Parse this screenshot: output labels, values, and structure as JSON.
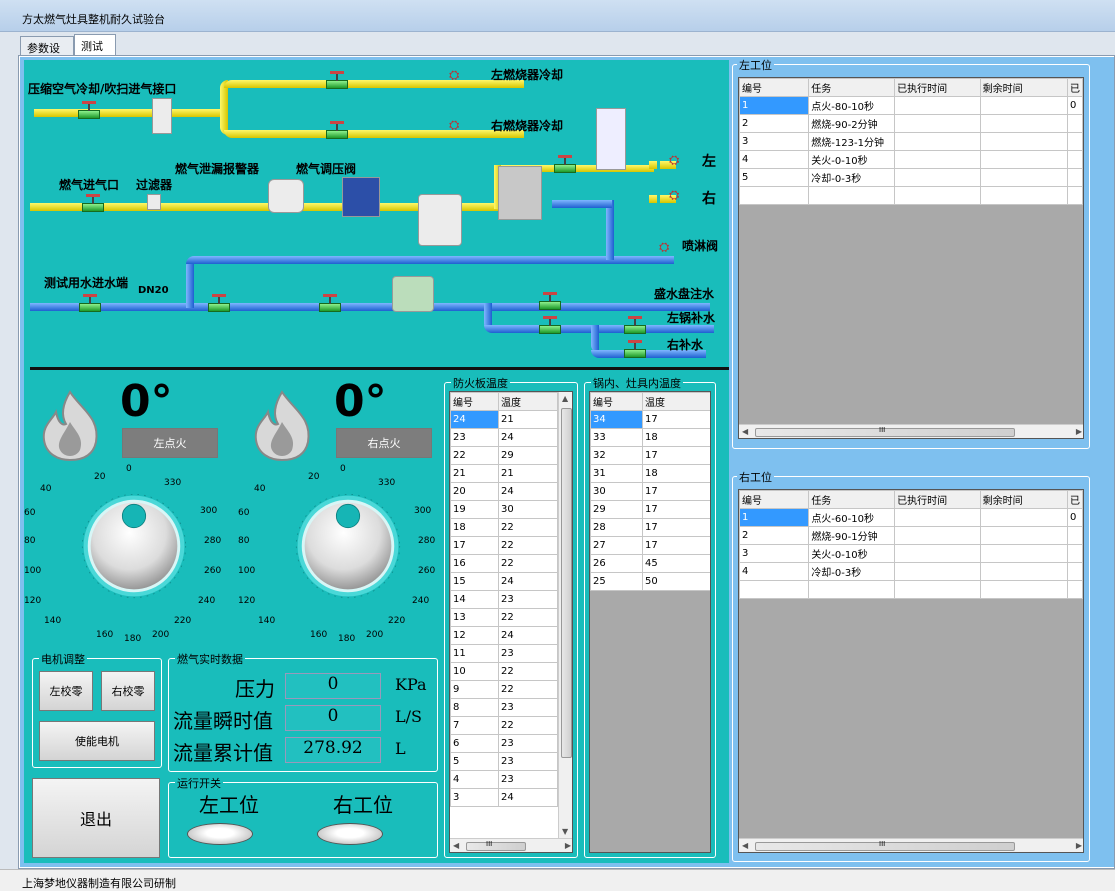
{
  "window": {
    "title": "方太燃气灶具整机耐久试验台"
  },
  "tabs": [
    "参数设置",
    "测试"
  ],
  "diagram": {
    "labels": {
      "air": "压缩空气冷却/吹扫进气接口",
      "left_burner_cool": "左燃烧器冷却",
      "right_burner_cool": "右燃烧器冷却",
      "gas_leak": "燃气泄漏报警器",
      "gas_reg": "燃气调压阀",
      "gas_in": "燃气进气口",
      "filter": "过滤器",
      "left": "左",
      "right": "右",
      "spray": "喷淋阀",
      "water_in": "测试用水进水端",
      "dn20": "DN20",
      "tray": "盛水盘注水",
      "left_pot": "左锅补水",
      "right_pot": "右补水"
    }
  },
  "left_burner": {
    "angle": "0°",
    "ignite": "左点火",
    "dial": [
      "0",
      "20",
      "40",
      "60",
      "80",
      "100",
      "120",
      "140",
      "160",
      "180",
      "200",
      "220",
      "240",
      "260",
      "280",
      "300",
      "330"
    ]
  },
  "right_burner": {
    "angle": "0°",
    "ignite": "右点火"
  },
  "motor": {
    "legend": "电机调整",
    "left_zero": "左校零",
    "right_zero": "右校零",
    "enable": "使能电机"
  },
  "gas": {
    "legend": "燃气实时数据",
    "pressure_label": "压力",
    "pressure": "0",
    "pressure_unit": "KPa",
    "flow_label": "流量瞬时值",
    "flow": "0",
    "flow_unit": "L/S",
    "total_label": "流量累计值",
    "total": "278.92",
    "total_unit": "L"
  },
  "run": {
    "legend": "运行开关",
    "left": "左工位",
    "right": "右工位"
  },
  "exit": "退出",
  "fireboard": {
    "legend": "防火板温度",
    "cols": [
      "编号",
      "温度"
    ],
    "rows": [
      [
        "24",
        "21"
      ],
      [
        "23",
        "24"
      ],
      [
        "22",
        "29"
      ],
      [
        "21",
        "21"
      ],
      [
        "20",
        "24"
      ],
      [
        "19",
        "30"
      ],
      [
        "18",
        "22"
      ],
      [
        "17",
        "22"
      ],
      [
        "16",
        "22"
      ],
      [
        "15",
        "24"
      ],
      [
        "14",
        "23"
      ],
      [
        "13",
        "22"
      ],
      [
        "12",
        "24"
      ],
      [
        "11",
        "23"
      ],
      [
        "10",
        "22"
      ],
      [
        "9",
        "22"
      ],
      [
        "8",
        "23"
      ],
      [
        "7",
        "22"
      ],
      [
        "6",
        "23"
      ],
      [
        "5",
        "23"
      ],
      [
        "4",
        "23"
      ],
      [
        "3",
        "24"
      ]
    ]
  },
  "pottemp": {
    "legend": "锅内、灶具内温度",
    "cols": [
      "编号",
      "温度"
    ],
    "rows": [
      [
        "34",
        "17"
      ],
      [
        "33",
        "18"
      ],
      [
        "32",
        "17"
      ],
      [
        "31",
        "18"
      ],
      [
        "30",
        "17"
      ],
      [
        "29",
        "17"
      ],
      [
        "28",
        "17"
      ],
      [
        "27",
        "17"
      ],
      [
        "26",
        "45"
      ],
      [
        "25",
        "50"
      ]
    ]
  },
  "left_station": {
    "legend": "左工位",
    "cols": [
      "编号",
      "任务",
      "已执行时间",
      "剩余时间",
      "已"
    ],
    "rows": [
      [
        "1",
        "点火-80-10秒",
        "",
        "",
        "0"
      ],
      [
        "2",
        "燃烧-90-2分钟",
        "",
        "",
        ""
      ],
      [
        "3",
        "燃烧-123-1分钟",
        "",
        "",
        ""
      ],
      [
        "4",
        "关火-0-10秒",
        "",
        "",
        ""
      ],
      [
        "5",
        "冷却-0-3秒",
        "",
        "",
        ""
      ],
      [
        "",
        "",
        "",
        "",
        ""
      ]
    ]
  },
  "right_station": {
    "legend": "右工位",
    "cols": [
      "编号",
      "任务",
      "已执行时间",
      "剩余时间",
      "已"
    ],
    "rows": [
      [
        "1",
        "点火-60-10秒",
        "",
        "",
        "0"
      ],
      [
        "2",
        "燃烧-90-1分钟",
        "",
        "",
        ""
      ],
      [
        "3",
        "关火-0-10秒",
        "",
        "",
        ""
      ],
      [
        "4",
        "冷却-0-3秒",
        "",
        "",
        ""
      ],
      [
        "",
        "",
        "",
        "",
        ""
      ]
    ]
  },
  "scroll_mark": "III",
  "status": "上海梦地仪器制造有限公司研制"
}
